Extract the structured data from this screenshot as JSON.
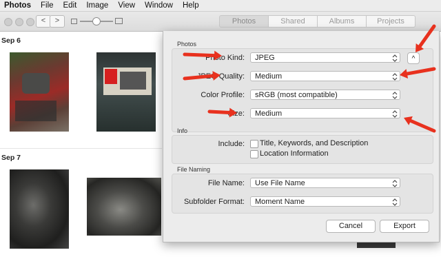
{
  "menubar": [
    "Photos",
    "File",
    "Edit",
    "Image",
    "View",
    "Window",
    "Help"
  ],
  "toolbar": {
    "tabs": [
      "Photos",
      "Shared",
      "Albums",
      "Projects"
    ],
    "back": "<",
    "forward": ">"
  },
  "grid": {
    "date1": "Sep 6",
    "date2": "Sep 7"
  },
  "sheet": {
    "photos_header": "Photos",
    "photo_kind_label": "Photo Kind:",
    "photo_kind_value": "JPEG",
    "quality_label": "JPEG Quality:",
    "quality_value": "Medium",
    "profile_label": "Color Profile:",
    "profile_value": "sRGB (most compatible)",
    "size_label": "Size:",
    "size_value": "Medium",
    "info_header": "Info",
    "include_label": "Include:",
    "include_opt1": "Title, Keywords, and Description",
    "include_opt2": "Location Information",
    "naming_header": "File Naming",
    "filename_label": "File Name:",
    "filename_value": "Use File Name",
    "subfolder_label": "Subfolder Format:",
    "subfolder_value": "Moment Name",
    "cancel": "Cancel",
    "export": "Export",
    "collapse": "^"
  },
  "annotation_color": "#e8311e"
}
